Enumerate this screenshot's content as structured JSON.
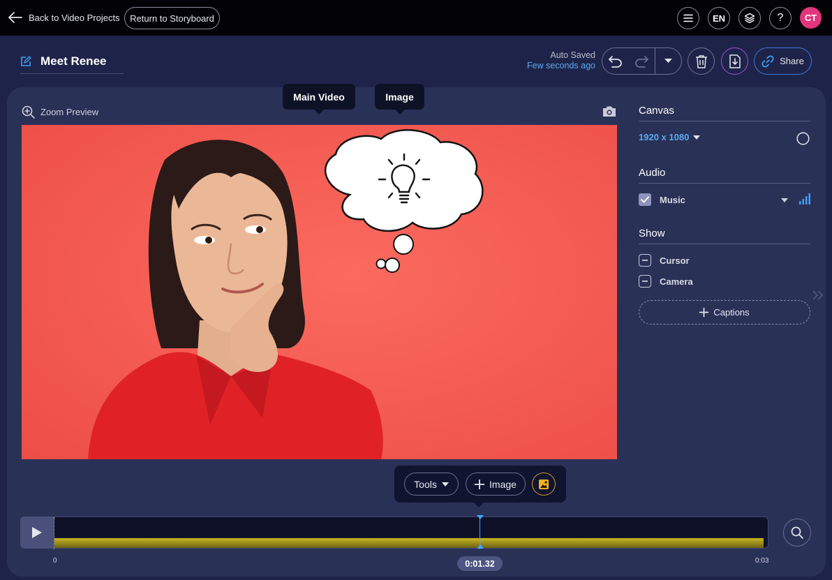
{
  "topbar": {
    "back_label": "Back to Video Projects",
    "storyboard_label": "Return to Storyboard",
    "language": "EN",
    "help": "?",
    "avatar_initials": "CT"
  },
  "project": {
    "title": "Meet Renee",
    "autosave_status": "Auto Saved",
    "autosave_time": "Few seconds ago",
    "share_label": "Share"
  },
  "preview": {
    "zoom_label": "Zoom Preview",
    "tooltip_main": "Main Video",
    "tooltip_image": "Image"
  },
  "toolbar": {
    "tools_label": "Tools",
    "image_label": "Image"
  },
  "timeline": {
    "start_label": "0",
    "end_label": "0:03",
    "current_time": "0:01.32"
  },
  "settings": {
    "canvas_title": "Canvas",
    "resolution": "1920 x 1080",
    "audio_title": "Audio",
    "music_label": "Music",
    "music_checked": true,
    "show_title": "Show",
    "cursor_label": "Cursor",
    "camera_label": "Camera",
    "captions_label": "Captions"
  },
  "colors": {
    "background": "#1e2449",
    "panel": "#2a3157",
    "accent_blue": "#5aa9f2",
    "avatar": "#e3357c",
    "canvas_red": "#f65a52",
    "audio_wave": "#c8b722"
  }
}
